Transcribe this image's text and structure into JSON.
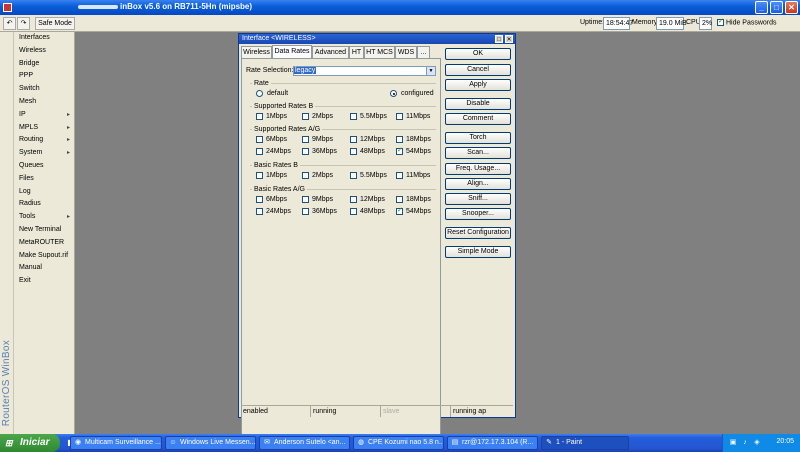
{
  "window": {
    "title": "inBox v5.6 on RB711-5Hn (mipsbe)",
    "controls": [
      "_",
      "□",
      "✕"
    ]
  },
  "toolbar": {
    "undo_icon": "undo-icon",
    "redo_icon": "redo-icon",
    "safe_mode": "Safe Mode",
    "uptime_label": "Uptime:",
    "uptime_value": "18:54:47",
    "memory_label": "Memory:",
    "memory_value": "19.0 MiB",
    "cpu_label": "CPU:",
    "cpu_value": "2%",
    "hide_passwords": "Hide Passwords",
    "hide_passwords_checked": true
  },
  "brand": "RouterOS WinBox",
  "sidebar": {
    "items": [
      {
        "label": "Interfaces",
        "submenu": false
      },
      {
        "label": "Wireless",
        "submenu": false
      },
      {
        "label": "Bridge",
        "submenu": false
      },
      {
        "label": "PPP",
        "submenu": false
      },
      {
        "label": "Switch",
        "submenu": false
      },
      {
        "label": "Mesh",
        "submenu": false
      },
      {
        "label": "IP",
        "submenu": true
      },
      {
        "label": "MPLS",
        "submenu": true
      },
      {
        "label": "Routing",
        "submenu": true
      },
      {
        "label": "System",
        "submenu": true
      },
      {
        "label": "Queues",
        "submenu": false
      },
      {
        "label": "Files",
        "submenu": false
      },
      {
        "label": "Log",
        "submenu": false
      },
      {
        "label": "Radius",
        "submenu": false
      },
      {
        "label": "Tools",
        "submenu": true
      },
      {
        "label": "New Terminal",
        "submenu": false
      },
      {
        "label": "MetaROUTER",
        "submenu": false
      },
      {
        "label": "Make Supout.rif",
        "submenu": false
      },
      {
        "label": "Manual",
        "submenu": false
      },
      {
        "label": "Exit",
        "submenu": false
      }
    ]
  },
  "dialog": {
    "title": "Interface <WIRELESS>",
    "tabs": [
      "Wireless",
      "Data Rates",
      "Advanced",
      "HT",
      "HT MCS",
      "WDS",
      "..."
    ],
    "active_tab": "Data Rates",
    "rate_selection_label": "Rate Selection:",
    "rate_selection_value": "legacy",
    "rate": {
      "title": "Rate",
      "options": [
        "default",
        "configured"
      ],
      "selected": "configured"
    },
    "supported_b": {
      "title": "Supported Rates B",
      "rates": [
        {
          "label": "1Mbps",
          "checked": false
        },
        {
          "label": "2Mbps",
          "checked": false
        },
        {
          "label": "5.5Mbps",
          "checked": false
        },
        {
          "label": "11Mbps",
          "checked": false
        }
      ]
    },
    "supported_ag": {
      "title": "Supported Rates A/G",
      "rates": [
        {
          "label": "6Mbps",
          "checked": false
        },
        {
          "label": "9Mbps",
          "checked": false
        },
        {
          "label": "12Mbps",
          "checked": false
        },
        {
          "label": "18Mbps",
          "checked": false
        },
        {
          "label": "24Mbps",
          "checked": false
        },
        {
          "label": "36Mbps",
          "checked": false
        },
        {
          "label": "48Mbps",
          "checked": false
        },
        {
          "label": "54Mbps",
          "checked": true
        }
      ]
    },
    "basic_b": {
      "title": "Basic Rates B",
      "rates": [
        {
          "label": "1Mbps",
          "checked": false
        },
        {
          "label": "2Mbps",
          "checked": false
        },
        {
          "label": "5.5Mbps",
          "checked": false
        },
        {
          "label": "11Mbps",
          "checked": false
        }
      ]
    },
    "basic_ag": {
      "title": "Basic Rates A/G",
      "rates": [
        {
          "label": "6Mbps",
          "checked": false
        },
        {
          "label": "9Mbps",
          "checked": false
        },
        {
          "label": "12Mbps",
          "checked": false
        },
        {
          "label": "18Mbps",
          "checked": false
        },
        {
          "label": "24Mbps",
          "checked": false
        },
        {
          "label": "36Mbps",
          "checked": false
        },
        {
          "label": "48Mbps",
          "checked": false
        },
        {
          "label": "54Mbps",
          "checked": true
        }
      ]
    },
    "buttons": [
      "OK",
      "Cancel",
      "Apply",
      "Disable",
      "Comment",
      "Torch",
      "Scan...",
      "Freq. Usage...",
      "Align...",
      "Sniff...",
      "Snooper...",
      "Reset Configuration",
      "Simple Mode"
    ],
    "status": [
      "enabled",
      "running",
      "slave",
      "running ap"
    ]
  },
  "taskbar": {
    "start_label": "Iniciar",
    "tasks": [
      {
        "label": "Multicam Surveillance ...",
        "icon": "camera-icon"
      },
      {
        "label": "Windows Live Messen...",
        "icon": "messenger-icon"
      },
      {
        "label": "Anderson Sutelo <an...",
        "icon": "mail-icon"
      },
      {
        "label": "CPE Kozumi nao 5.8 n...",
        "icon": "firefox-icon"
      },
      {
        "label": "rzr@172.17.3.104 (R...",
        "icon": "winbox-icon"
      },
      {
        "label": "1 - Paint",
        "icon": "paint-icon"
      }
    ],
    "clock": "20:05"
  }
}
